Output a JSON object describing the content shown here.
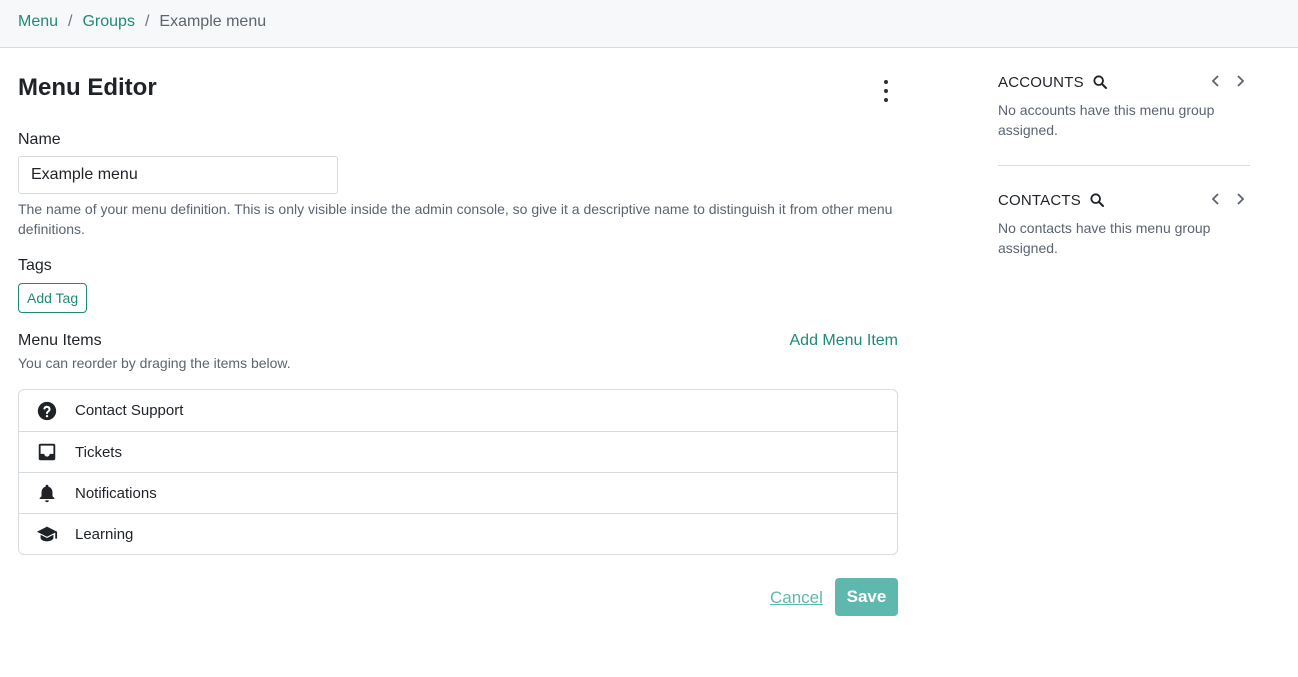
{
  "breadcrumb": {
    "menu": "Menu",
    "groups": "Groups",
    "current": "Example menu",
    "separator": "/"
  },
  "editor": {
    "title": "Menu Editor",
    "name_label": "Name",
    "name_value": "Example menu",
    "name_help": "The name of your menu definition. This is only visible inside the admin console, so give it a descriptive name to distinguish it from other menu definitions.",
    "tags_label": "Tags",
    "add_tag": "Add Tag",
    "items_label": "Menu Items",
    "add_item": "Add Menu Item",
    "items_help": "You can reorder by draging the items below.",
    "items": [
      {
        "label": "Contact Support",
        "icon": "question-circle-icon"
      },
      {
        "label": "Tickets",
        "icon": "inbox-icon"
      },
      {
        "label": "Notifications",
        "icon": "bell-icon"
      },
      {
        "label": "Learning",
        "icon": "graduation-cap-icon"
      }
    ],
    "cancel": "Cancel",
    "save": "Save"
  },
  "sidebar": {
    "accounts": {
      "title": "ACCOUNTS",
      "empty": "No accounts have this menu group assigned."
    },
    "contacts": {
      "title": "CONTACTS",
      "empty": "No contacts have this menu group assigned."
    }
  },
  "colors": {
    "accent": "#1f8a78",
    "accent_light": "#5fb8ad",
    "border": "#d7dbe0",
    "muted": "#5b6470"
  }
}
